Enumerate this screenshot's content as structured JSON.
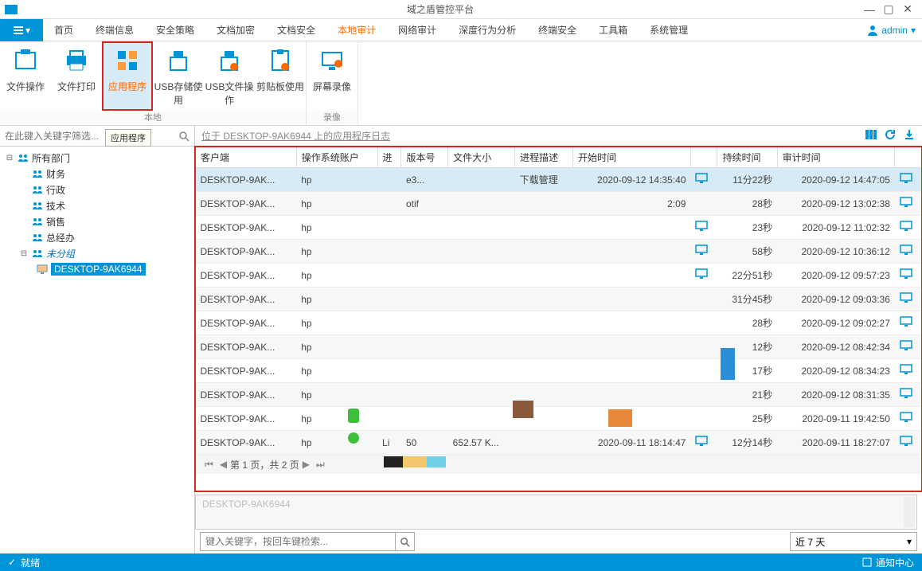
{
  "window": {
    "title": "域之盾管控平台"
  },
  "user": {
    "name": "admin"
  },
  "tabs": [
    "首页",
    "终端信息",
    "安全策略",
    "文档加密",
    "文档安全",
    "本地审计",
    "网络审计",
    "深度行为分析",
    "终端安全",
    "工具箱",
    "系统管理"
  ],
  "tabs_active": 5,
  "ribbon": {
    "g1": {
      "label": "本地",
      "items": [
        {
          "label": "文件操作"
        },
        {
          "label": "文件打印"
        },
        {
          "label": "应用程序",
          "active": true
        },
        {
          "label": "USB存储使用"
        },
        {
          "label": "USB文件操作"
        },
        {
          "label": "剪贴板使用"
        }
      ]
    },
    "g2": {
      "label": "录像",
      "items": [
        {
          "label": "屏幕录像"
        }
      ]
    }
  },
  "sidebar": {
    "search_ph": "在此键入关键字筛选...",
    "tooltip": "应用程序",
    "root": "所有部门",
    "depts": [
      "财务",
      "行政",
      "技术",
      "销售",
      "总经办"
    ],
    "unassigned": "未分组",
    "host": "DESKTOP-9AK6944"
  },
  "content": {
    "title": "位于 DESKTOP-9AK6944 上的应用程序日志",
    "columns": [
      "客户端",
      "操作系统账户",
      "进",
      "版本号",
      "文件大小",
      "进程描述",
      "开始时间",
      "",
      "持续时间",
      "审计时间",
      ""
    ],
    "rows": [
      {
        "c": "DESKTOP-9AK...",
        "u": "hp",
        "v": "e3...",
        "d": "下载管理",
        "s": "2020-09-12 14:35:40",
        "m": 1,
        "dur": "11分22秒",
        "a": "2020-09-12 14:47:05",
        "hi": 1
      },
      {
        "c": "DESKTOP-9AK...",
        "u": "hp",
        "v": "otif",
        "s": "2:09",
        "dur": "28秒",
        "a": "2020-09-12 13:02:38"
      },
      {
        "c": "DESKTOP-9AK...",
        "u": "hp",
        "m": 1,
        "dur": "23秒",
        "a": "2020-09-12 11:02:32"
      },
      {
        "c": "DESKTOP-9AK...",
        "u": "hp",
        "m": 1,
        "dur": "58秒",
        "a": "2020-09-12 10:36:12"
      },
      {
        "c": "DESKTOP-9AK...",
        "u": "hp",
        "m": 1,
        "dur": "22分51秒",
        "a": "2020-09-12 09:57:23"
      },
      {
        "c": "DESKTOP-9AK...",
        "u": "hp",
        "dur": "31分45秒",
        "a": "2020-09-12 09:03:36"
      },
      {
        "c": "DESKTOP-9AK...",
        "u": "hp",
        "dur": "28秒",
        "a": "2020-09-12 09:02:27"
      },
      {
        "c": "DESKTOP-9AK...",
        "u": "hp",
        "dur": "12秒",
        "a": "2020-09-12 08:42:34"
      },
      {
        "c": "DESKTOP-9AK...",
        "u": "hp",
        "dur": "17秒",
        "a": "2020-09-12 08:34:23"
      },
      {
        "c": "DESKTOP-9AK...",
        "u": "hp",
        "dur": "21秒",
        "a": "2020-09-12 08:31:35"
      },
      {
        "c": "DESKTOP-9AK...",
        "u": "hp",
        "dur": "25秒",
        "a": "2020-09-11 19:42:50"
      },
      {
        "c": "DESKTOP-9AK...",
        "u": "hp",
        "p": "Li",
        "v": "50",
        "fs": "652.57 K...",
        "s": "2020-09-11 18:14:47",
        "m": 1,
        "dur": "12分14秒",
        "a": "2020-09-11 18:27:07"
      }
    ],
    "pager": "第 1 页，共 2 页",
    "detail": "DESKTOP-9AK6944",
    "keyword_ph": "键入关键字，按回车键检索...",
    "period": "近 7 天"
  },
  "status": {
    "left": "就绪",
    "right": "通知中心"
  }
}
